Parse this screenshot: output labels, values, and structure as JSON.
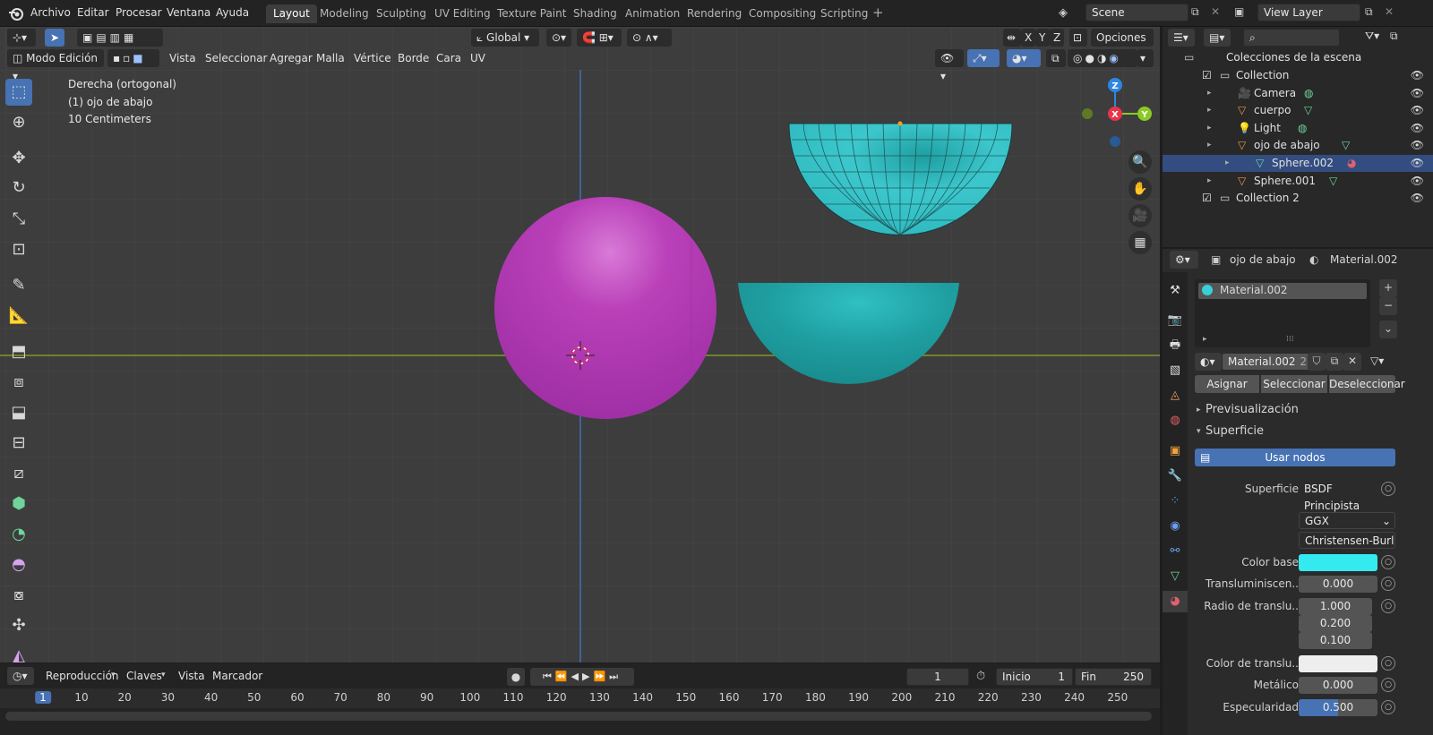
{
  "topbar": {
    "menus": [
      "Archivo",
      "Editar",
      "Procesar",
      "Ventana",
      "Ayuda"
    ],
    "workspaces": [
      "Layout",
      "Modeling",
      "Sculpting",
      "UV Editing",
      "Texture Paint",
      "Shading",
      "Animation",
      "Rendering",
      "Compositing",
      "Scripting"
    ],
    "active_workspace": "Layout",
    "scene": "Scene",
    "view_layer": "View Layer"
  },
  "viewport_header": {
    "mode": "Modo Edición",
    "menus": [
      "Vista",
      "Seleccionar",
      "Agregar",
      "Malla",
      "Vértice",
      "Borde",
      "Cara",
      "UV"
    ],
    "orientation": "Global",
    "axes": [
      "X",
      "Y",
      "Z"
    ],
    "options": "Opciones"
  },
  "viewport_overlay": {
    "view_name": "Derecha (ortogonal)",
    "object_name": "(1) ojo de abajo",
    "scale": "10 Centimeters"
  },
  "gizmo": {
    "z": "Z",
    "x": "X",
    "y": "Y"
  },
  "colors": {
    "magenta_sphere": "#b03ab4",
    "cyan_mesh": "#2fb8bf",
    "cyan_lower": "#1f9c9e",
    "accent_blue": "#4772b3",
    "color_base": "#34eaf0",
    "translucency_color": "#eeeeee",
    "x_axis": "#e8344b",
    "y_axis": "#8bc926",
    "z_axis": "#2e86e3"
  },
  "timeline": {
    "menus": [
      "Reproducción",
      "Claves",
      "Vista",
      "Marcador"
    ],
    "current_frame": "1",
    "start_label": "Inicio",
    "start": "1",
    "end_label": "Fin",
    "end": "250",
    "ruler": [
      "1",
      "10",
      "20",
      "30",
      "40",
      "50",
      "60",
      "70",
      "80",
      "90",
      "100",
      "110",
      "120",
      "130",
      "140",
      "150",
      "160",
      "170",
      "180",
      "190",
      "200",
      "210",
      "220",
      "230",
      "240",
      "250"
    ]
  },
  "outliner": {
    "root": "Colecciones de la escena",
    "items": [
      {
        "label": "Collection",
        "indent": 0,
        "type": "collection"
      },
      {
        "label": "Camera",
        "indent": 1,
        "type": "camera"
      },
      {
        "label": "cuerpo",
        "indent": 1,
        "type": "mesh"
      },
      {
        "label": "Light",
        "indent": 1,
        "type": "light"
      },
      {
        "label": "ojo de abajo",
        "indent": 1,
        "type": "mesh"
      },
      {
        "label": "Sphere.002",
        "indent": 2,
        "type": "meshdata",
        "selected": true
      },
      {
        "label": "Sphere.001",
        "indent": 1,
        "type": "mesh"
      },
      {
        "label": "Collection 2",
        "indent": 0,
        "type": "collection"
      }
    ]
  },
  "properties": {
    "breadcrumb_object": "ojo de abajo",
    "breadcrumb_material": "Material.002",
    "slot": "Material.002",
    "material_name": "Material.002",
    "users": "2",
    "buttons": [
      "Asignar",
      "Seleccionar",
      "Deseleccionar"
    ],
    "sections": {
      "preview": "Previsualización",
      "surface": "Superficie"
    },
    "use_nodes": "Usar nodos",
    "surface_label": "Superficie",
    "surface_value": "BSDF Principista",
    "distribution": "GGX",
    "subsurface_method": "Christensen-Burle",
    "rows": [
      {
        "label": "Color base",
        "value": ""
      },
      {
        "label": "Transluminiscen..",
        "value": "0.000"
      },
      {
        "label": "Radio de translu..",
        "value": "1.000"
      },
      {
        "label": "",
        "value": "0.200"
      },
      {
        "label": "",
        "value": "0.100"
      },
      {
        "label": "Color de translu..",
        "value": ""
      },
      {
        "label": "Metálico",
        "value": "0.000"
      },
      {
        "label": "Especularidad",
        "value": "0.500"
      }
    ],
    "specular_fill": 0.5
  }
}
